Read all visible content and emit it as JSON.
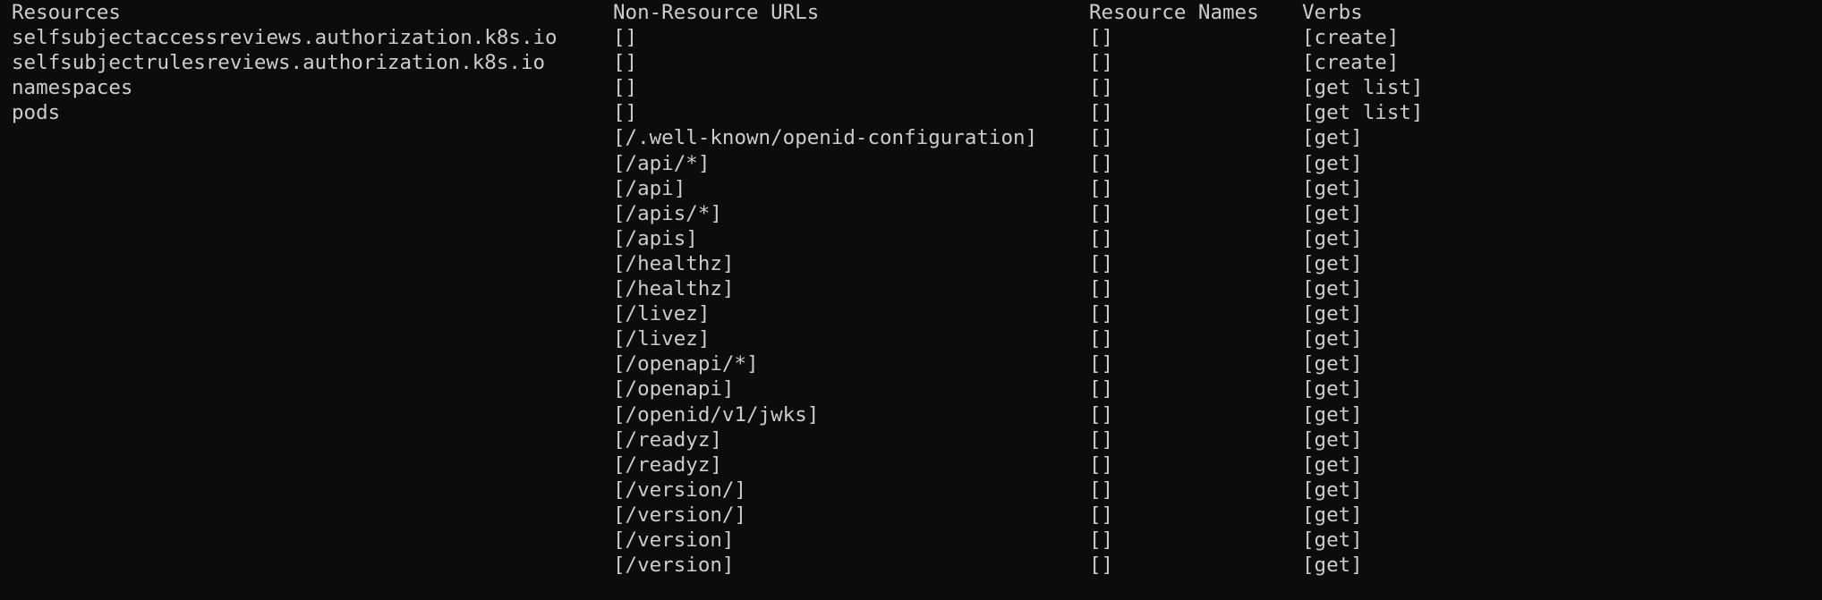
{
  "colors": {
    "background": "#0c0c0c",
    "text": "#cccccc"
  },
  "headers": [
    "Resources",
    "Non-Resource URLs",
    "Resource Names",
    "Verbs"
  ],
  "rows": [
    [
      "selfsubjectaccessreviews.authorization.k8s.io",
      "[]",
      "[]",
      "[create]"
    ],
    [
      "selfsubjectrulesreviews.authorization.k8s.io",
      "[]",
      "[]",
      "[create]"
    ],
    [
      "namespaces",
      "[]",
      "[]",
      "[get list]"
    ],
    [
      "pods",
      "[]",
      "[]",
      "[get list]"
    ],
    [
      "",
      "[/.well-known/openid-configuration]",
      "[]",
      "[get]"
    ],
    [
      "",
      "[/api/*]",
      "[]",
      "[get]"
    ],
    [
      "",
      "[/api]",
      "[]",
      "[get]"
    ],
    [
      "",
      "[/apis/*]",
      "[]",
      "[get]"
    ],
    [
      "",
      "[/apis]",
      "[]",
      "[get]"
    ],
    [
      "",
      "[/healthz]",
      "[]",
      "[get]"
    ],
    [
      "",
      "[/healthz]",
      "[]",
      "[get]"
    ],
    [
      "",
      "[/livez]",
      "[]",
      "[get]"
    ],
    [
      "",
      "[/livez]",
      "[]",
      "[get]"
    ],
    [
      "",
      "[/openapi/*]",
      "[]",
      "[get]"
    ],
    [
      "",
      "[/openapi]",
      "[]",
      "[get]"
    ],
    [
      "",
      "[/openid/v1/jwks]",
      "[]",
      "[get]"
    ],
    [
      "",
      "[/readyz]",
      "[]",
      "[get]"
    ],
    [
      "",
      "[/readyz]",
      "[]",
      "[get]"
    ],
    [
      "",
      "[/version/]",
      "[]",
      "[get]"
    ],
    [
      "",
      "[/version/]",
      "[]",
      "[get]"
    ],
    [
      "",
      "[/version]",
      "[]",
      "[get]"
    ],
    [
      "",
      "[/version]",
      "[]",
      "[get]"
    ]
  ]
}
